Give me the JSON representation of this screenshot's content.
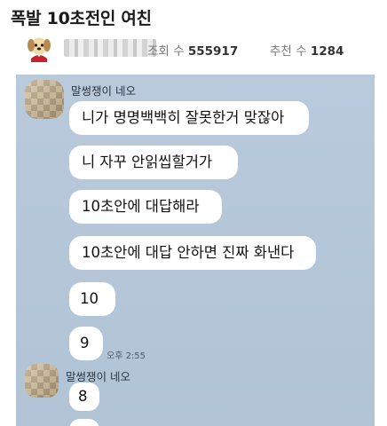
{
  "post": {
    "title": "폭발 10초전인 여친",
    "views_label": "조회 수",
    "views": "555917",
    "recommends_label": "추천 수",
    "recommends": "1284"
  },
  "chat": {
    "sender_name": "말썽쟁이 네오",
    "messages": [
      "니가 명명백백히 잘못한거 맞잖아",
      "니 자꾸 안읽씹할거가",
      "10초안에 대답해라",
      "10초안에 대답 안하면 진짜 화낸다",
      "10",
      "9",
      "8"
    ],
    "timestamp": "오후 2:55"
  },
  "icons": {
    "author_avatar": "dog-avatar-icon",
    "profile": "pixelated-profile-photo"
  },
  "colors": {
    "chat_background": "#b6c9da",
    "bubble": "#ffffff",
    "title_text": "#1a1a1a"
  }
}
